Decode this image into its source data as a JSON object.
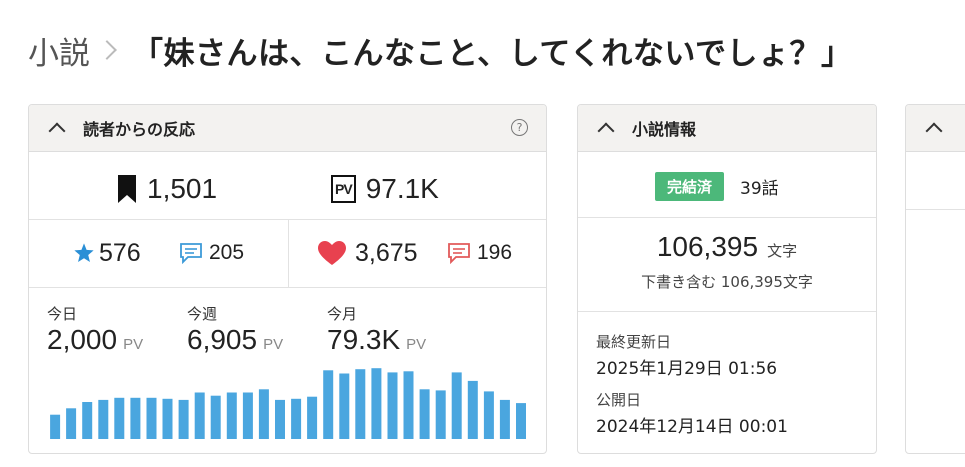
{
  "header": {
    "breadcrumb_parent": "小説",
    "title": "「妹さんは、こんなこと、してくれないでしょ？」"
  },
  "reactions": {
    "title": "読者からの反応",
    "help_icon": "?",
    "bookmarks": "1,501",
    "pv_total": "97.1K",
    "pv_icon_text": "PV",
    "stars": "576",
    "star_comments": "205",
    "hearts": "3,675",
    "heart_comments": "196",
    "today_label": "今日",
    "today_value": "2,000",
    "week_label": "今週",
    "week_value": "6,905",
    "month_label": "今月",
    "month_value": "79.3K",
    "pv_unit": "PV",
    "colors": {
      "star": "#2a8fd6",
      "heart": "#e8414f",
      "bar": "#4aa6df",
      "comment_blue": "#3c9ad8",
      "comment_red": "#e25a5a"
    }
  },
  "chart_data": {
    "type": "bar",
    "title": "",
    "xlabel": "",
    "ylabel": "",
    "values": [
      23,
      29,
      35,
      37,
      39,
      39,
      39,
      38,
      37,
      44,
      41,
      44,
      44,
      47,
      37,
      38,
      40,
      65,
      62,
      66,
      67,
      63,
      64,
      47,
      46,
      63,
      55,
      45,
      37,
      34
    ],
    "ylim": [
      0,
      70
    ]
  },
  "novel_info": {
    "title": "小説情報",
    "status": "完結済",
    "episodes": "39話",
    "char_count": "106,395",
    "char_unit": "文字",
    "draft_note": "下書き含む 106,395文字",
    "updated_label": "最終更新日",
    "updated_value": "2025年1月29日 01:56",
    "published_label": "公開日",
    "published_value": "2024年12月14日 00:01",
    "colors": {
      "badge": "#4cb87a"
    }
  }
}
